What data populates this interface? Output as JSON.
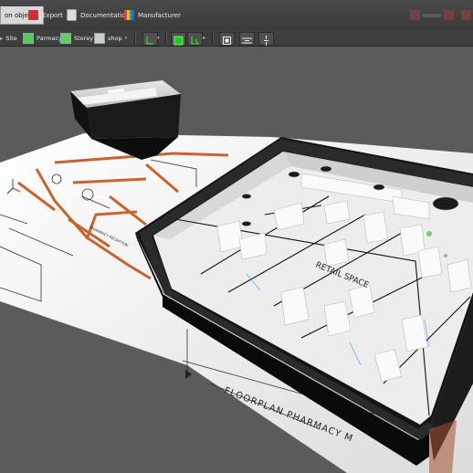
{
  "tabs": [
    {
      "label": "on objects",
      "active": true
    },
    {
      "label": "Export"
    },
    {
      "label": "Documentation"
    },
    {
      "label": "Manufacturer"
    }
  ],
  "toolbar2": {
    "site_label": "Site",
    "building_label": "Parmacy",
    "storey_label": "Storey",
    "view_label": "shop"
  },
  "plan": {
    "retail_label": "RETAIL SPACE",
    "floorplan_title": "FLOORPLAN PHARMACY M",
    "small_labels": [
      "PHARMACY RECEPTION"
    ]
  },
  "colors": {
    "toolbar": "#3a3a3a",
    "viewport_bg": "#5b5b5b",
    "walls": "#1b1b1b",
    "plan_brick": "#c8632f"
  }
}
